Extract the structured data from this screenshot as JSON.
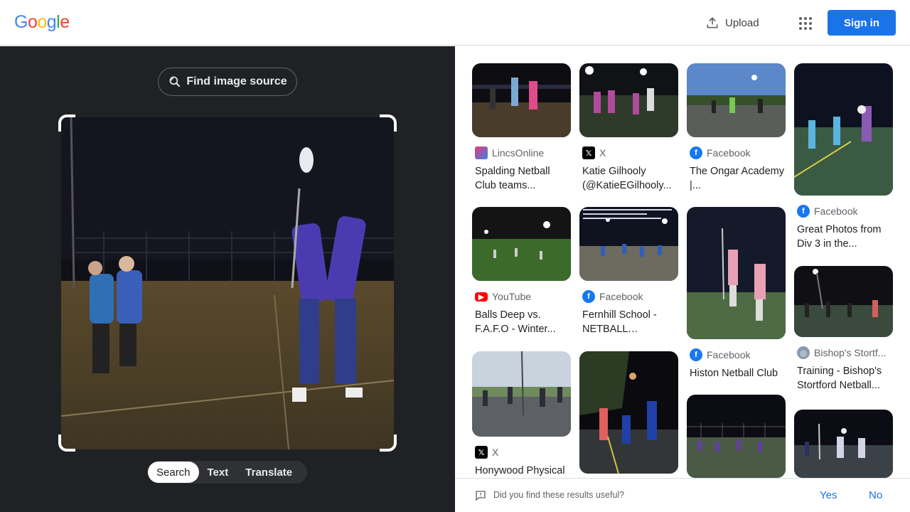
{
  "header": {
    "logo": "Google",
    "upload_label": "Upload",
    "signin_label": "Sign in"
  },
  "lens": {
    "find_source_label": "Find image source",
    "modes": [
      {
        "label": "Search",
        "active": true
      },
      {
        "label": "Text",
        "active": false
      },
      {
        "label": "Translate",
        "active": false
      }
    ]
  },
  "results": [
    {
      "source": "LincsOnline",
      "icon": "lincsonline-icon",
      "title": "Spalding Netball Club teams..."
    },
    {
      "source": "X",
      "icon": "x-logo-icon",
      "title": "Katie Gilhooly (@KatieEGilhooly..."
    },
    {
      "source": "Facebook",
      "icon": "facebook-icon",
      "title": "The Ongar Academy |..."
    },
    {
      "source": "Facebook",
      "icon": "facebook-icon",
      "title": "Great Photos from Div 3 in the..."
    },
    {
      "source": "YouTube",
      "icon": "youtube-icon",
      "title": "Balls Deep vs. F.A.F.O - Winter..."
    },
    {
      "source": "Facebook",
      "icon": "facebook-icon",
      "title": "Fernhill School - NETBALL FESTIVA..."
    },
    {
      "source": "Facebook",
      "icon": "facebook-icon",
      "title": "Histon Netball Club"
    },
    {
      "source": "Bishop's Stortf...",
      "icon": "globe-icon",
      "title": "Training - Bishop's Stortford Netball..."
    },
    {
      "source": "X",
      "icon": "x-logo-icon",
      "title": "Honywood Physical"
    },
    {
      "source": "",
      "icon": "",
      "title": ""
    },
    {
      "source": "",
      "icon": "",
      "title": ""
    },
    {
      "source": "",
      "icon": "",
      "title": ""
    }
  ],
  "feedback": {
    "question": "Did you find these results useful?",
    "yes_label": "Yes",
    "no_label": "No"
  },
  "colors": {
    "accent": "#1a73e8",
    "left_panel_bg": "#202124",
    "facebook": "#1877f2",
    "youtube": "#ff0000"
  }
}
